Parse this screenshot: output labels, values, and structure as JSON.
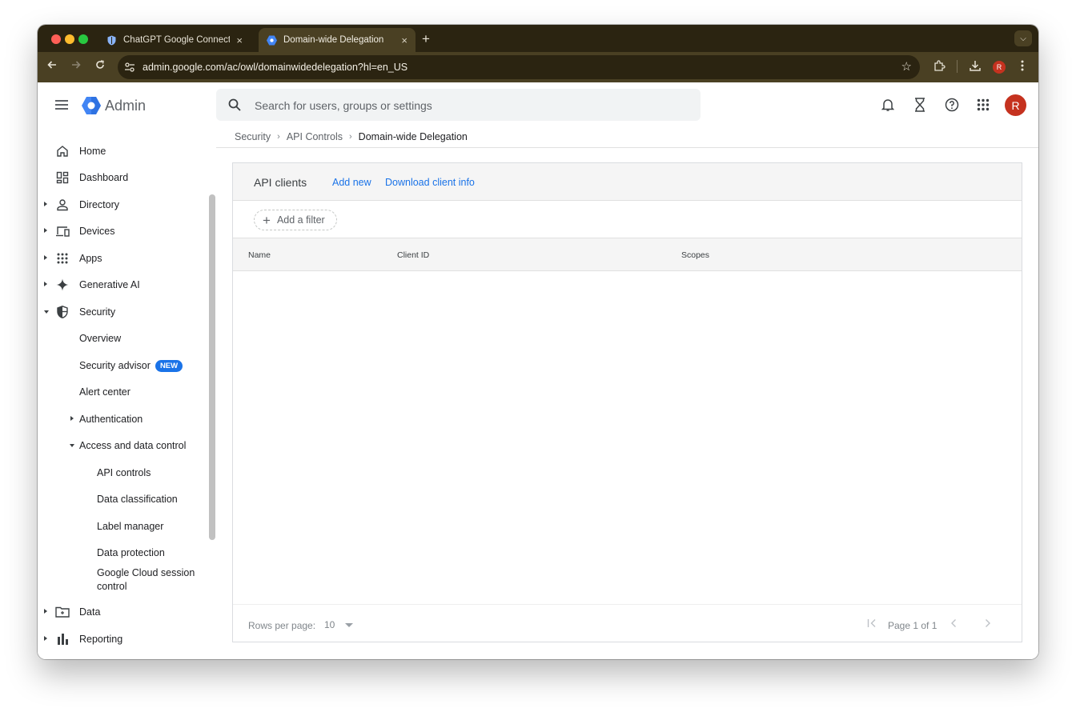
{
  "browser": {
    "tabs": [
      {
        "title": "ChatGPT Google Connector -",
        "active": false
      },
      {
        "title": "Domain-wide Delegation",
        "active": true
      }
    ],
    "new_tab_label": "+",
    "close_label": "×",
    "url": "admin.google.com/ac/owl/domainwidedelegation?hl=en_US",
    "profile_initial": "R",
    "colors": {
      "frame": "#2b2411",
      "toolbar": "#4a4023",
      "profile": "#c5321f"
    }
  },
  "header": {
    "brand": "Admin",
    "search_placeholder": "Search for users, groups or settings",
    "icons": [
      "bell-icon",
      "hourglass-icon",
      "help-icon",
      "apps-grid-icon"
    ],
    "avatar_initial": "R"
  },
  "sidebar": {
    "items": [
      {
        "label": "Home",
        "icon": "home-icon"
      },
      {
        "label": "Dashboard",
        "icon": "dashboard-icon"
      },
      {
        "label": "Directory",
        "icon": "person-icon",
        "caret": "right"
      },
      {
        "label": "Devices",
        "icon": "devices-icon",
        "caret": "right"
      },
      {
        "label": "Apps",
        "icon": "apps-icon",
        "caret": "right"
      },
      {
        "label": "Generative AI",
        "icon": "sparkle-icon",
        "caret": "right"
      },
      {
        "label": "Security",
        "icon": "shield-icon",
        "caret": "down"
      },
      {
        "label": "Overview"
      },
      {
        "label": "Security advisor",
        "badge": "NEW"
      },
      {
        "label": "Alert center"
      },
      {
        "label": "Authentication",
        "caret": "right"
      },
      {
        "label": "Access and data control",
        "caret": "down"
      },
      {
        "label": "API controls"
      },
      {
        "label": "Data classification"
      },
      {
        "label": "Label manager"
      },
      {
        "label": "Data protection"
      },
      {
        "label": "Google Cloud session",
        "label2": "control"
      },
      {
        "label": "Data",
        "icon": "folder-icon",
        "caret": "right"
      },
      {
        "label": "Reporting",
        "icon": "bar-chart-icon",
        "caret": "right"
      }
    ]
  },
  "breadcrumb": {
    "items": [
      "Security",
      "API Controls"
    ],
    "current": "Domain-wide Delegation",
    "separator": "›"
  },
  "main": {
    "card_title": "API clients",
    "add_new": "Add new",
    "download": "Download client info",
    "filter_label": "Add a filter",
    "columns": [
      "Name",
      "Client ID",
      "Scopes"
    ],
    "rows": [],
    "footer": {
      "rows_per_page_label": "Rows per page:",
      "rows_per_page_value": "10",
      "page_text": "Page 1 of 1"
    }
  }
}
